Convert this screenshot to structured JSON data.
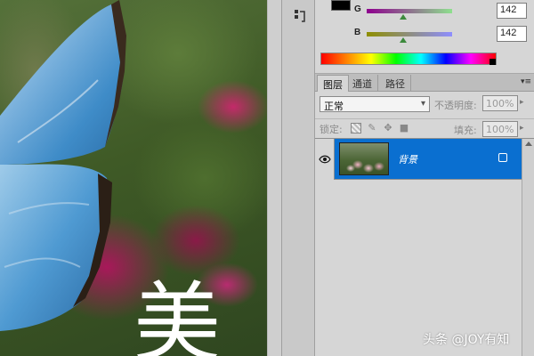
{
  "overlay": {
    "char": "美"
  },
  "color_panel": {
    "rows": [
      {
        "label": "G",
        "value": "142"
      },
      {
        "label": "B",
        "value": "142"
      }
    ]
  },
  "layers_panel": {
    "tabs": [
      {
        "label": "图层"
      },
      {
        "label": "通道"
      },
      {
        "label": "路径"
      }
    ],
    "blend_mode": "正常",
    "opacity_label": "不透明度:",
    "opacity_value": "100%",
    "lock_label": "锁定:",
    "fill_label": "填充:",
    "fill_value": "100%",
    "layers": [
      {
        "name": "背景"
      }
    ]
  },
  "watermark": "头条 @JOY有知"
}
